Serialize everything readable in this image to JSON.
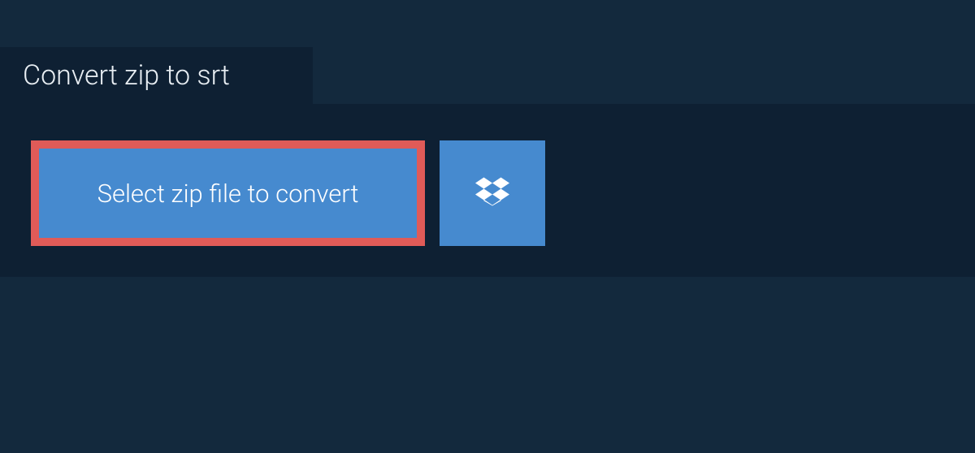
{
  "tab": {
    "title": "Convert zip to srt"
  },
  "actions": {
    "select_file_label": "Select zip file to convert"
  }
}
